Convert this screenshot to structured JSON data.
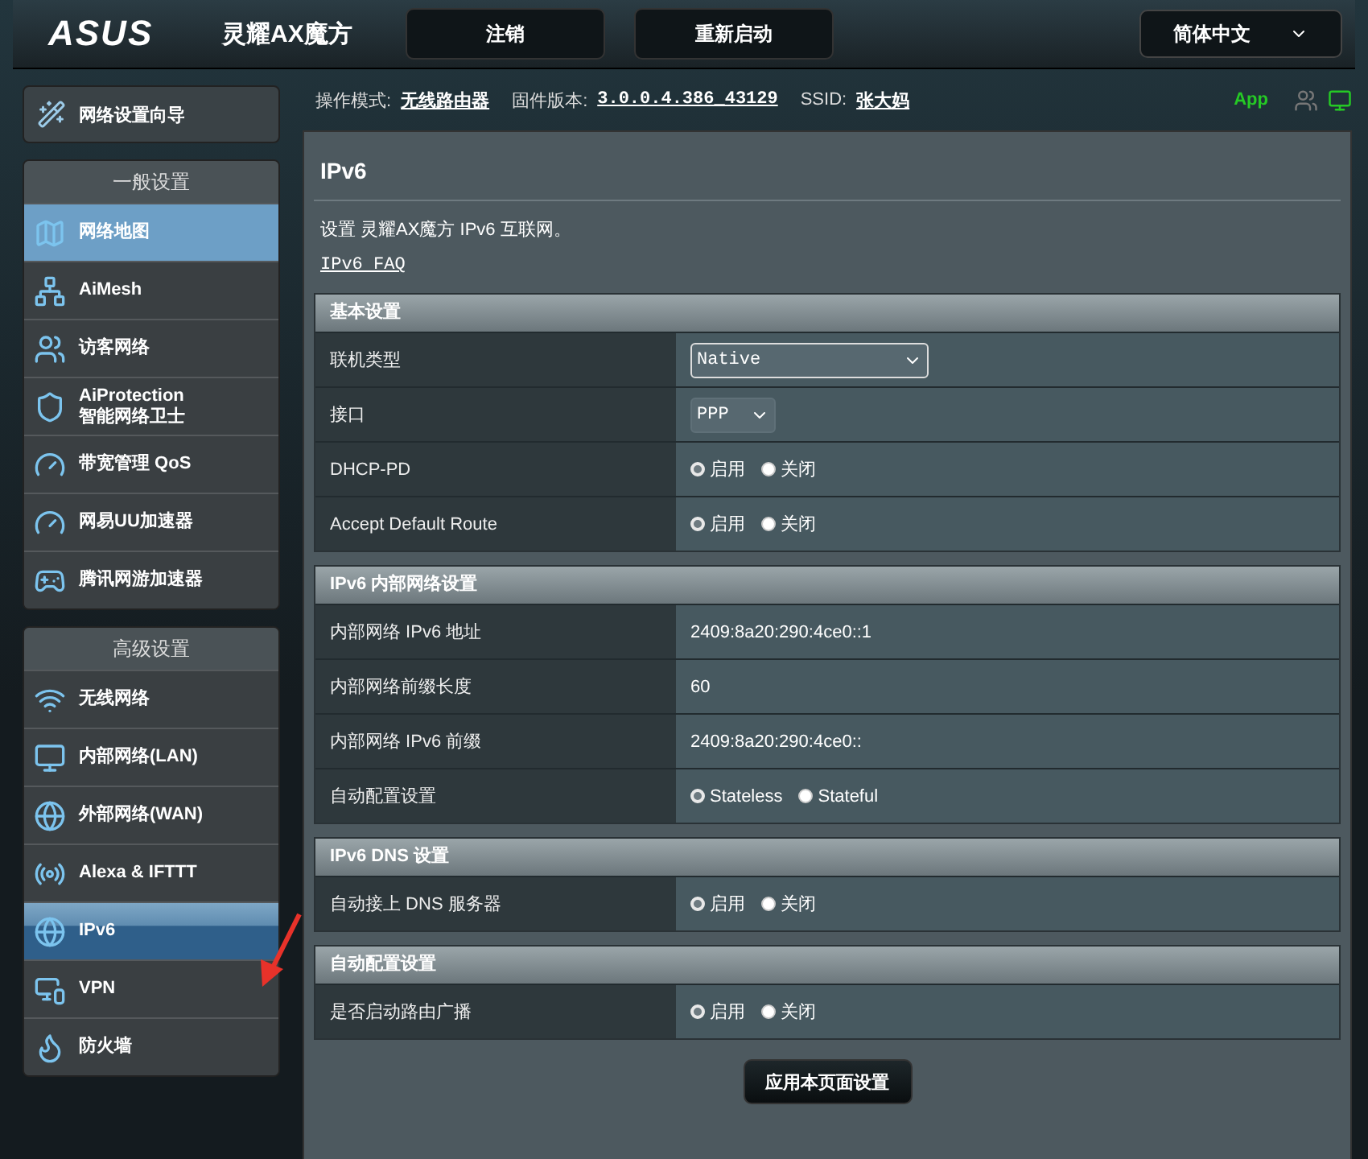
{
  "header": {
    "logo": "ASUS",
    "product": "灵耀AX魔方",
    "buttons": [
      "注销",
      "重新启动"
    ],
    "language": "简体中文"
  },
  "status": {
    "mode_label": "操作模式:",
    "mode_value": "无线路由器",
    "firmware_label": "固件版本:",
    "firmware_value": "3.0.0.4.386_43129",
    "ssid_label": "SSID:",
    "ssid_value": "张大妈",
    "app_label": "App"
  },
  "sidebar": {
    "wizard": "网络设置向导",
    "groups": [
      {
        "title": "一般设置",
        "items": [
          {
            "label": "网络地图",
            "kind": "map",
            "selected": false,
            "hovered": true
          },
          {
            "label": "AiMesh",
            "kind": "mesh",
            "selected": false,
            "hovered": false
          },
          {
            "label": "访客网络",
            "kind": "guest",
            "selected": false,
            "hovered": false
          },
          {
            "label": "AiProtection",
            "sublabel": "智能网络卫士",
            "kind": "shield",
            "selected": false,
            "hovered": false
          },
          {
            "label": "带宽管理 QoS",
            "kind": "gauge",
            "selected": false,
            "hovered": false
          },
          {
            "label": "网易UU加速器",
            "kind": "gauge",
            "selected": false,
            "hovered": false
          },
          {
            "label": "腾讯网游加速器",
            "kind": "game",
            "selected": false,
            "hovered": false
          }
        ]
      },
      {
        "title": "高级设置",
        "items": [
          {
            "label": "无线网络",
            "kind": "wifi",
            "selected": false,
            "hovered": false
          },
          {
            "label": "内部网络(LAN)",
            "kind": "lan",
            "selected": false,
            "hovered": false
          },
          {
            "label": "外部网络(WAN)",
            "kind": "globe",
            "selected": false,
            "hovered": false
          },
          {
            "label": "Alexa & IFTTT",
            "kind": "alexa",
            "selected": false,
            "hovered": false
          },
          {
            "label": "IPv6",
            "kind": "ipv6",
            "selected": true,
            "hovered": false
          },
          {
            "label": "VPN",
            "kind": "vpn",
            "selected": false,
            "hovered": false
          },
          {
            "label": "防火墙",
            "kind": "fire",
            "selected": false,
            "hovered": false
          }
        ]
      }
    ]
  },
  "page": {
    "title": "IPv6",
    "description": "设置 灵耀AX魔方 IPv6 互联网。",
    "faq_link": "IPv6 FAQ",
    "sections": [
      {
        "title": "基本设置",
        "rows": [
          {
            "label": "联机类型",
            "kind": "select",
            "value": "Native",
            "wide": true
          },
          {
            "label": "接口",
            "kind": "select",
            "value": "PPP",
            "wide": false
          },
          {
            "label": "DHCP-PD",
            "kind": "radio",
            "options": [
              {
                "label": "启用",
                "selected": true
              },
              {
                "label": "关闭",
                "selected": false
              }
            ]
          },
          {
            "label": "Accept Default Route",
            "kind": "radio",
            "options": [
              {
                "label": "启用",
                "selected": true
              },
              {
                "label": "关闭",
                "selected": false
              }
            ]
          }
        ]
      },
      {
        "title": "IPv6 内部网络设置",
        "rows": [
          {
            "label": "内部网络 IPv6 地址",
            "kind": "text",
            "value": "2409:8a20:290:4ce0::1"
          },
          {
            "label": "内部网络前缀长度",
            "kind": "text",
            "value": "60"
          },
          {
            "label": "内部网络 IPv6 前缀",
            "kind": "text",
            "value": "2409:8a20:290:4ce0::"
          },
          {
            "label": "自动配置设置",
            "kind": "radio",
            "options": [
              {
                "label": "Stateless",
                "selected": true
              },
              {
                "label": "Stateful",
                "selected": false
              }
            ]
          }
        ]
      },
      {
        "title": "IPv6 DNS 设置",
        "rows": [
          {
            "label": "自动接上 DNS 服务器",
            "kind": "radio",
            "options": [
              {
                "label": "启用",
                "selected": true
              },
              {
                "label": "关闭",
                "selected": false
              }
            ]
          }
        ]
      },
      {
        "title": "自动配置设置",
        "rows": [
          {
            "label": "是否启动路由广播",
            "kind": "radio",
            "options": [
              {
                "label": "启用",
                "selected": true
              },
              {
                "label": "关闭",
                "selected": false
              }
            ]
          }
        ]
      }
    ],
    "apply_button": "应用本页面设置"
  }
}
